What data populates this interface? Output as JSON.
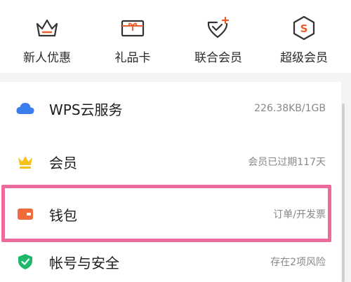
{
  "benefits": [
    {
      "label": "新人优惠",
      "icon": "crown-outline-icon"
    },
    {
      "label": "礼品卡",
      "icon": "gift-card-icon"
    },
    {
      "label": "联合会员",
      "icon": "heart-badge-icon"
    },
    {
      "label": "超级会员",
      "icon": "super-member-hexagon-icon"
    }
  ],
  "list": [
    {
      "title": "WPS云服务",
      "value": "226.38KB/1GB",
      "icon": "cloud-icon",
      "icon_color": "#3b7ded"
    },
    {
      "title": "会员",
      "value": "会员已过期117天",
      "icon": "crown-icon",
      "icon_color": "#f5c21b"
    },
    {
      "title": "钱包",
      "value": "订单/开发票",
      "icon": "wallet-icon",
      "icon_color": "#f06a3c"
    },
    {
      "title": "帐号与安全",
      "value": "存在2项风险",
      "icon": "shield-check-icon",
      "icon_color": "#1fb86a"
    }
  ],
  "colors": {
    "accent": "#e85d2a",
    "highlight_border": "#ec6b9c"
  }
}
